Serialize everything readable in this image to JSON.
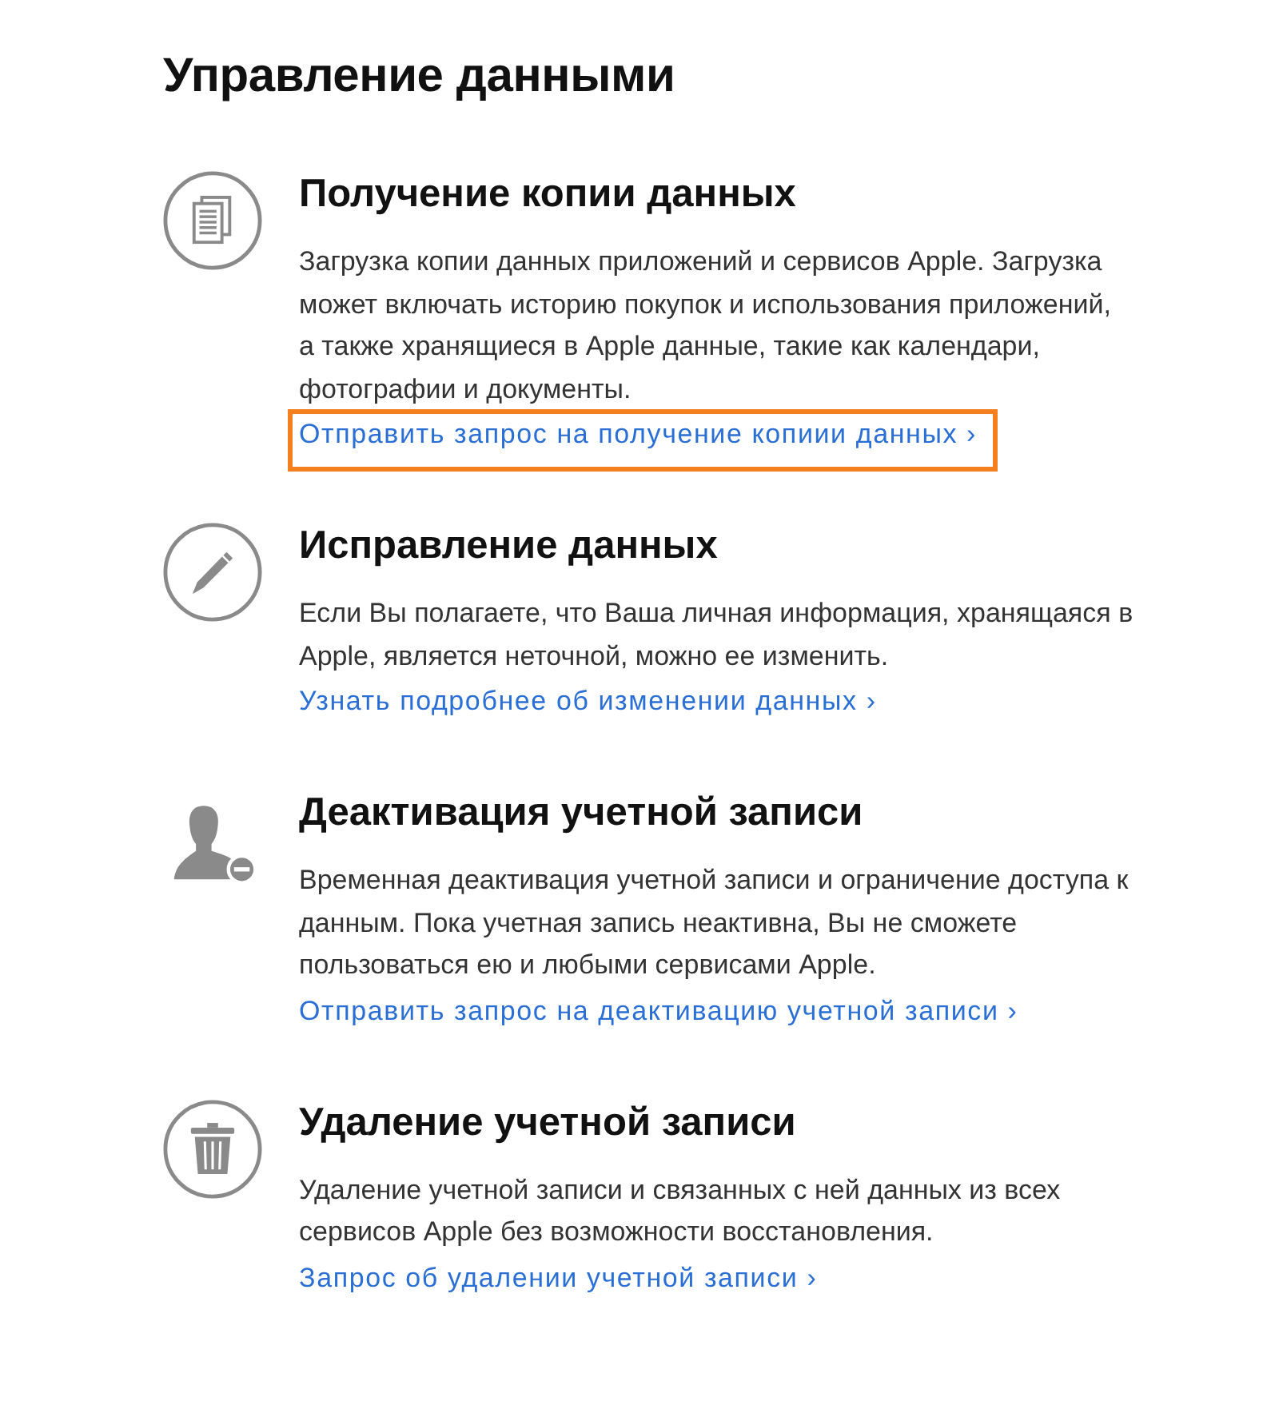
{
  "page": {
    "title": "Управление данными"
  },
  "sections": [
    {
      "kind": "document",
      "heading": "Получение копии данных",
      "text": "Загрузка копии данных приложений и сервисов Apple. Загрузка\nможет включать историю покупок и использования приложений,\nа также хранящиеся в Apple данные, такие как календари,\nфотографии и документы.",
      "link": "Отправить запрос на получение копиии данных ›",
      "highlighted": true
    },
    {
      "kind": "pencil",
      "heading": "Исправление данных",
      "text": "Если Вы полагаете, что Ваша личная информация, хранящаяся в\nApple, является неточной, можно ее изменить.",
      "link": "Узнать подробнее об изменении данных ›",
      "highlighted": false
    },
    {
      "kind": "person",
      "heading": "Деактивация учетной записи",
      "text": "Временная деактивация учетной записи и ограничение доступа к\nданным. Пока учетная запись неактивна, Вы не сможете\nпользоваться ею и любыми сервисами Apple.",
      "link": "Отправить запрос на деактивацию учетной записи ›",
      "highlighted": false
    },
    {
      "kind": "trash",
      "heading": "Удаление учетной записи",
      "text": "Удаление учетной записи и связанных с ней данных из всех\nсервисов Apple без возможности восстановления.",
      "link": "Запрос об удалении учетной записи ›",
      "highlighted": false
    }
  ]
}
